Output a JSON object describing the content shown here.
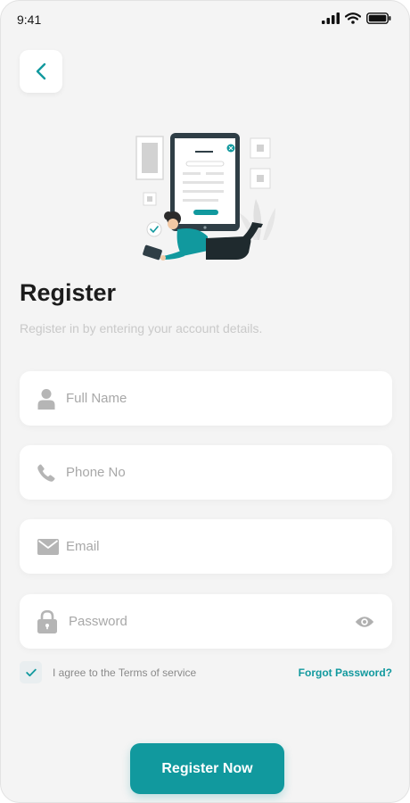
{
  "status_bar": {
    "time": "9:41"
  },
  "header": {
    "back_icon": "chevron-left-icon"
  },
  "title": "Register",
  "subtitle": "Register in by entering your account details.",
  "form": {
    "full_name": {
      "placeholder": "Full Name",
      "icon": "user-icon"
    },
    "phone": {
      "placeholder": "Phone No",
      "icon": "phone-icon"
    },
    "email": {
      "placeholder": "Email",
      "icon": "mail-icon"
    },
    "password": {
      "placeholder": "Password",
      "icon": "lock-icon",
      "toggle_icon": "eye-icon"
    }
  },
  "terms": {
    "label": "I agree to the Terms of service",
    "checked": true
  },
  "forgot_password": "Forgot Password?",
  "register_button": "Register Now",
  "colors": {
    "accent": "#11999e",
    "background": "#f4f4f4",
    "field": "#ffffff",
    "placeholder": "#a8a8a8",
    "icon": "#b5b5b5"
  }
}
